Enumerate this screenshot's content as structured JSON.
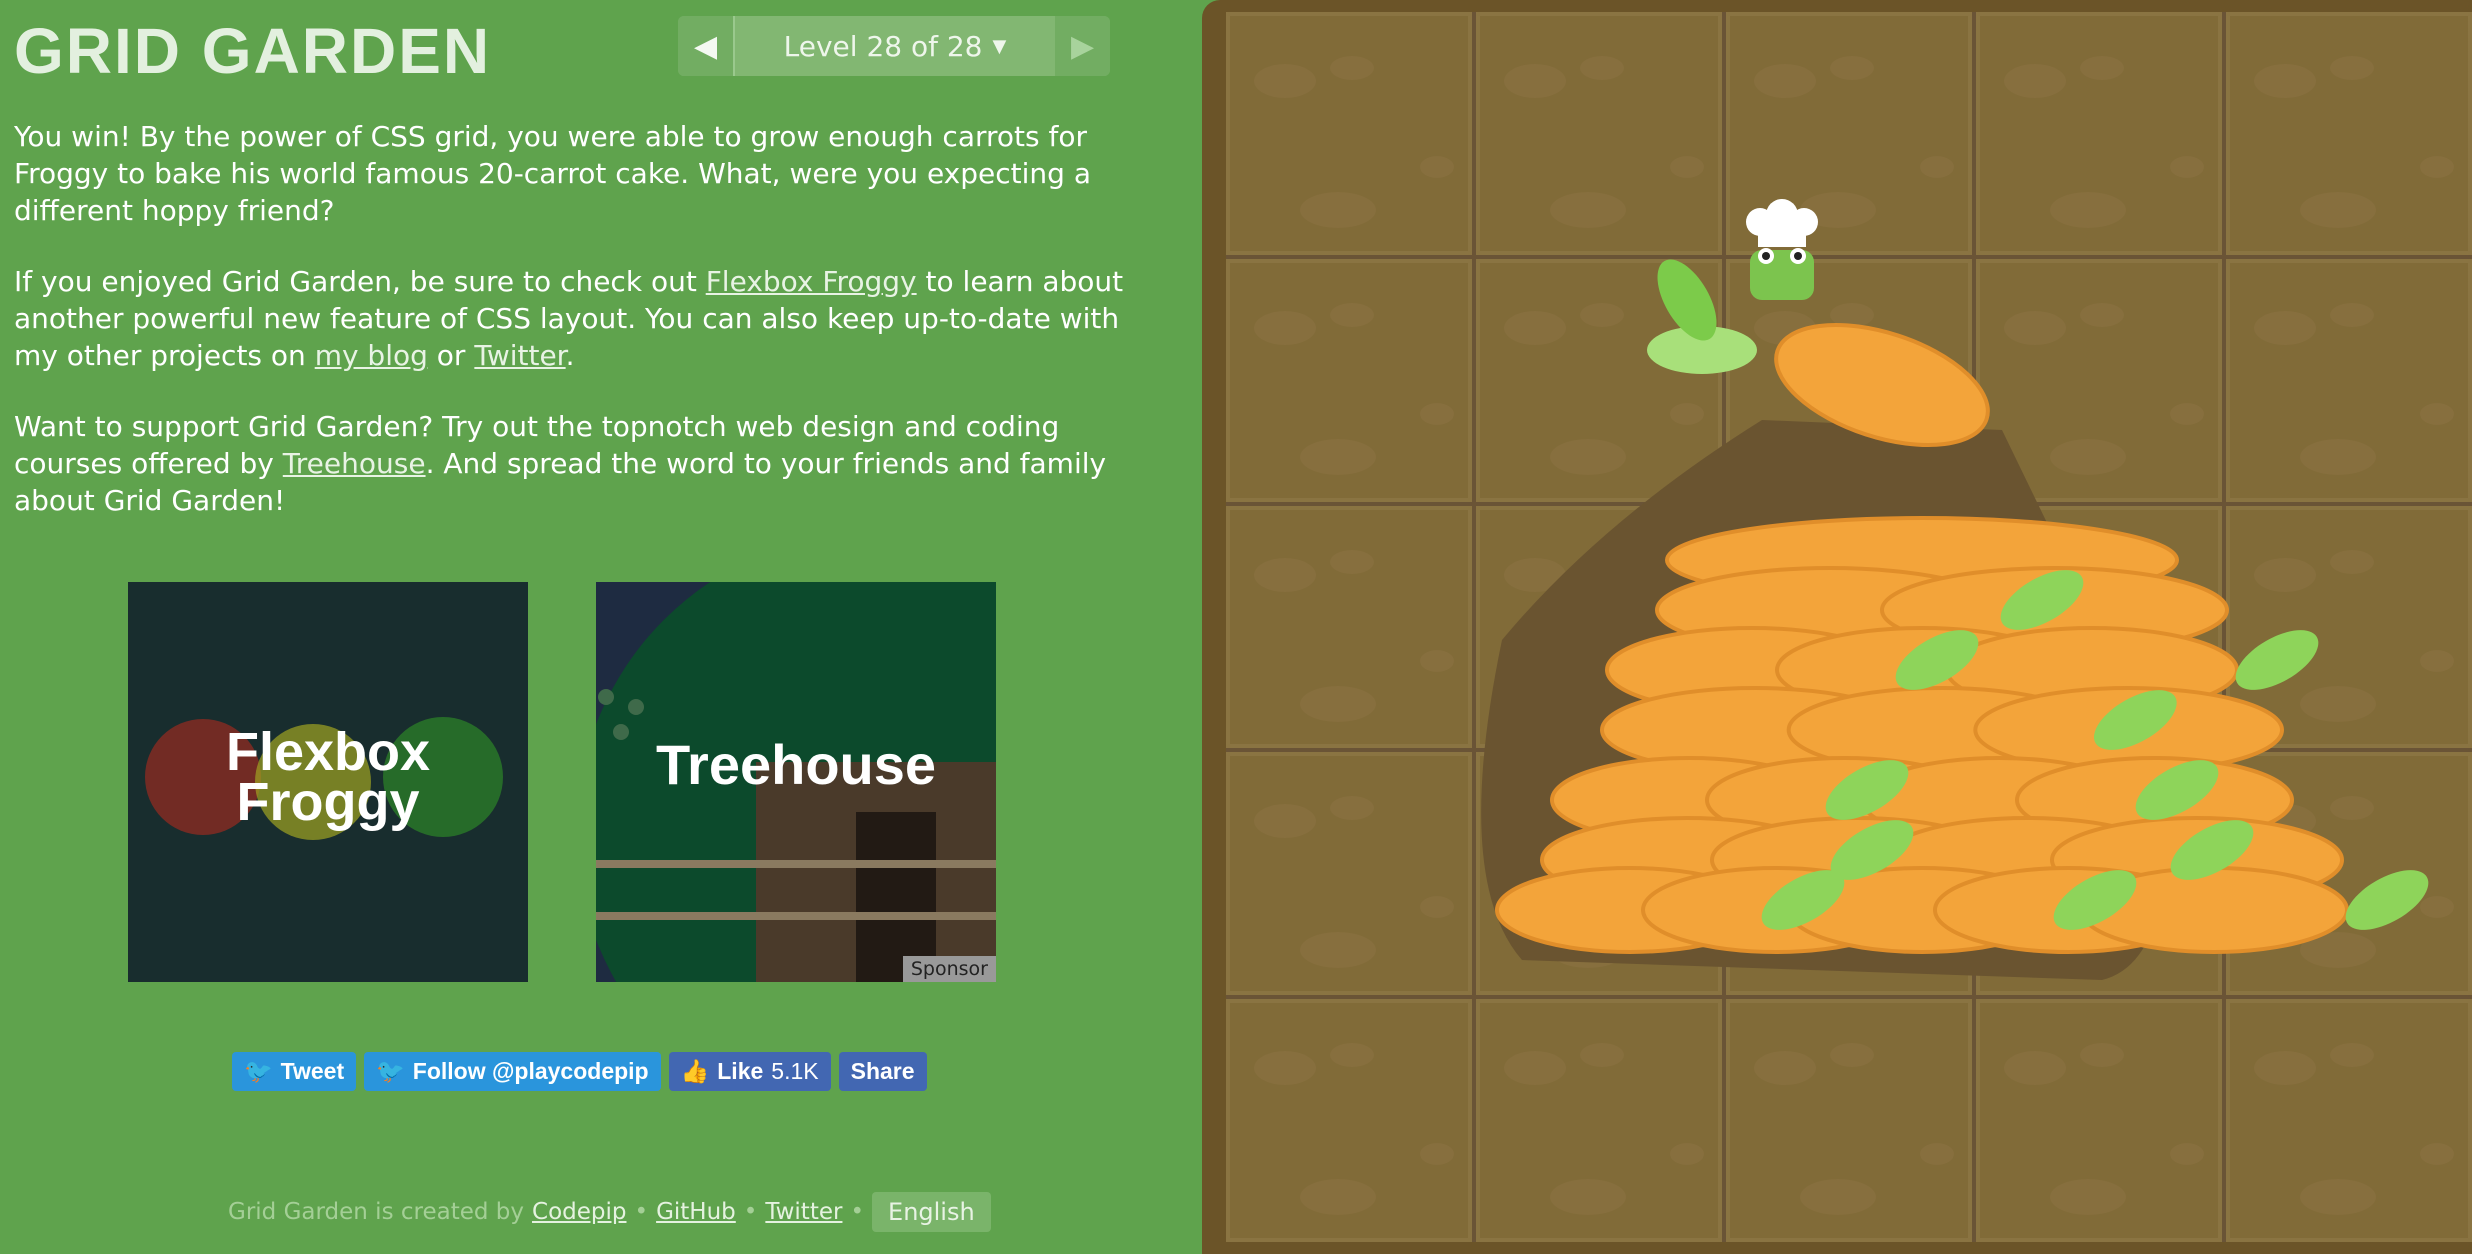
{
  "header": {
    "title": "GRID GARDEN",
    "level_label": "Level 28 of 28",
    "prev_icon": "triangle-left-icon",
    "next_icon": "triangle-right-icon",
    "dropdown_icon": "caret-down-icon"
  },
  "content": {
    "p1": "You win! By the power of CSS grid, you were able to grow enough carrots for Froggy to bake his world famous 20-carrot cake. What, were you expecting a different hoppy friend?",
    "p2": {
      "t1": "If you enjoyed Grid Garden, be sure to check out ",
      "link1": "Flexbox Froggy",
      "t2": " to learn about another powerful new feature of CSS layout. You can also keep up-to-date with my other projects on ",
      "link2": "my blog",
      "t3": " or ",
      "link3": "Twitter",
      "t4": "."
    },
    "p3": {
      "t1": "Want to support Grid Garden? Try out the topnotch web design and coding courses offered by ",
      "link1": "Treehouse",
      "t2": ". And spread the word to your friends and family about Grid Garden!"
    }
  },
  "promos": {
    "froggy_line1": "Flexbox",
    "froggy_line2": "Froggy",
    "treehouse": "Treehouse",
    "sponsor": "Sponsor"
  },
  "social": {
    "tweet": "Tweet",
    "follow": "Follow @playcodepip",
    "like": "Like",
    "like_count": "5.1K",
    "share": "Share"
  },
  "footer": {
    "text": "Grid Garden is created by",
    "codepip": "Codepip",
    "github": "GitHub",
    "twitter": "Twitter",
    "sep": "•",
    "language": "English"
  },
  "colors": {
    "background": "#5fa34d",
    "soil": "#816b38",
    "carrot": "#f3a43a",
    "twitter": "#2a95dc",
    "facebook": "#4267b2"
  }
}
